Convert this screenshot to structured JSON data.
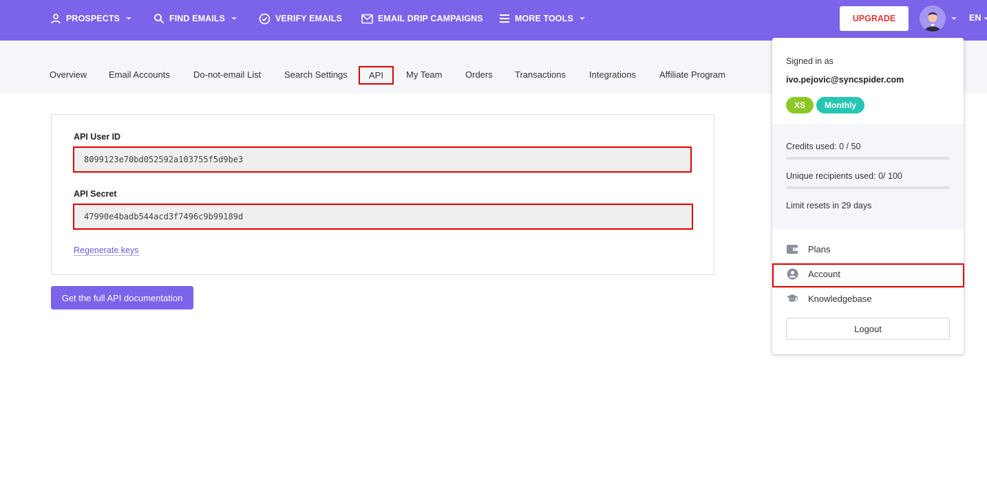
{
  "topnav": {
    "items": [
      {
        "label": "PROSPECTS",
        "icon": "person-icon"
      },
      {
        "label": "FIND EMAILS",
        "icon": "search-icon"
      },
      {
        "label": "VERIFY EMAILS",
        "icon": "check-circle-icon"
      },
      {
        "label": "EMAIL DRIP CAMPAIGNS",
        "icon": "envelope-icon"
      },
      {
        "label": "MORE TOOLS",
        "icon": "menu-icon"
      }
    ],
    "upgrade_label": "UPGRADE",
    "language": "EN"
  },
  "tabs": [
    {
      "label": "Overview"
    },
    {
      "label": "Email Accounts"
    },
    {
      "label": "Do-not-email List"
    },
    {
      "label": "Search Settings"
    },
    {
      "label": "API",
      "active": true
    },
    {
      "label": "My Team"
    },
    {
      "label": "Orders"
    },
    {
      "label": "Transactions"
    },
    {
      "label": "Integrations"
    },
    {
      "label": "Affiliate Program"
    }
  ],
  "api": {
    "user_id_label": "API User ID",
    "user_id_value": "8099123e70bd052592a103755f5d9be3",
    "secret_label": "API Secret",
    "secret_value": "47990e4badb544acd3f7496c9b99189d",
    "regenerate_label": "Regenerate keys",
    "docs_button_label": "Get the full API documentation"
  },
  "dropdown": {
    "signed_in_label": "Signed in as",
    "email": "ivo.pejovic@syncspider.com",
    "badges": [
      {
        "label": "XS",
        "color": "#8bc926"
      },
      {
        "label": "Monthly",
        "color": "#26c6b4"
      }
    ],
    "credits_label": "Credits used: 0 / 50",
    "credits_fraction": 0,
    "recipients_label": "Unique recipients used: 0/ 100",
    "recipients_fraction": 0,
    "limit_reset_label": "Limit resets in 29 days",
    "menu": [
      {
        "label": "Plans",
        "icon": "wallet-icon"
      },
      {
        "label": "Account",
        "icon": "user-circle-icon"
      },
      {
        "label": "Knowledgebase",
        "icon": "graduation-cap-icon"
      }
    ],
    "logout_label": "Logout"
  },
  "colors": {
    "brand": "#7b63ea",
    "highlight": "#e00000",
    "upgrade_text": "#e53935"
  }
}
